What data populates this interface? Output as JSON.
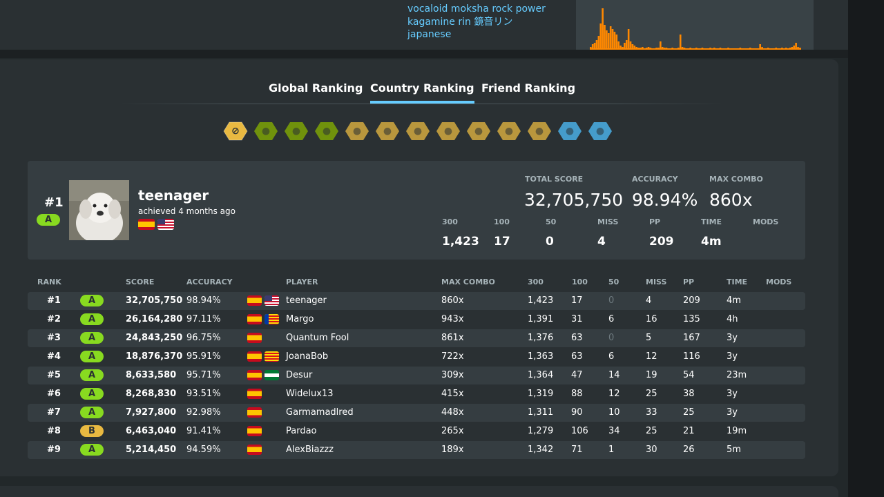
{
  "tags": [
    "vocaloid moksha rock power",
    "kagamine rin 鏡音リン",
    "japanese"
  ],
  "tabs": [
    {
      "label": "Global Ranking",
      "active": false
    },
    {
      "label": "Country Ranking",
      "active": true
    },
    {
      "label": "Friend Ranking",
      "active": false
    }
  ],
  "mods": [
    {
      "name": "no-mod",
      "color": "#e9b941"
    },
    {
      "name": "easy",
      "color": "#88b300"
    },
    {
      "name": "no-fail",
      "color": "#88b300"
    },
    {
      "name": "half-time",
      "color": "#88b300"
    },
    {
      "name": "hard-rock",
      "color": "#e9b941"
    },
    {
      "name": "sudden-death",
      "color": "#e9b941"
    },
    {
      "name": "perfect",
      "color": "#e9b941"
    },
    {
      "name": "double-time",
      "color": "#e9b941"
    },
    {
      "name": "hidden",
      "color": "#e9b941"
    },
    {
      "name": "flashlight",
      "color": "#e9b941"
    },
    {
      "name": "spun-out",
      "color": "#e9b941"
    },
    {
      "name": "relax",
      "color": "#4fc0ff"
    },
    {
      "name": "auto",
      "color": "#4fc0ff"
    }
  ],
  "top_score": {
    "rank": "#1",
    "grade": "A",
    "player": "teenager",
    "achieved": "achieved 4 months ago",
    "flags": [
      "es",
      "us"
    ],
    "labels": {
      "total_score": "TOTAL SCORE",
      "accuracy": "ACCURACY",
      "max_combo": "MAX COMBO",
      "c300": "300",
      "c100": "100",
      "c50": "50",
      "miss": "MISS",
      "pp": "PP",
      "time": "TIME",
      "mods": "MODS"
    },
    "total_score": "32,705,750",
    "accuracy": "98.94%",
    "max_combo": "860x",
    "c300": "1,423",
    "c100": "17",
    "c50": "0",
    "miss": "4",
    "pp": "209",
    "time": "4m"
  },
  "table_headers": {
    "rank": "RANK",
    "score": "SCORE",
    "accuracy": "ACCURACY",
    "player": "PLAYER",
    "max_combo": "MAX COMBO",
    "c300": "300",
    "c100": "100",
    "c50": "50",
    "miss": "MISS",
    "pp": "PP",
    "time": "TIME",
    "mods": "MODS"
  },
  "rows": [
    {
      "rank": "#1",
      "grade": "A",
      "score": "32,705,750",
      "accuracy": "98.94%",
      "flags": [
        "es",
        "us"
      ],
      "player": "teenager",
      "max_combo": "860x",
      "c300": "1,423",
      "c100": "17",
      "c50": "0",
      "miss": "4",
      "pp": "209",
      "time": "4m"
    },
    {
      "rank": "#2",
      "grade": "A",
      "score": "26,164,280",
      "accuracy": "97.11%",
      "flags": [
        "es",
        "vl"
      ],
      "player": "Margo",
      "max_combo": "943x",
      "c300": "1,391",
      "c100": "31",
      "c50": "6",
      "miss": "16",
      "pp": "135",
      "time": "4h"
    },
    {
      "rank": "#3",
      "grade": "A",
      "score": "24,843,250",
      "accuracy": "96.75%",
      "flags": [
        "es"
      ],
      "player": "Quantum Fool",
      "max_combo": "861x",
      "c300": "1,376",
      "c100": "63",
      "c50": "0",
      "miss": "5",
      "pp": "167",
      "time": "3y"
    },
    {
      "rank": "#4",
      "grade": "A",
      "score": "18,876,370",
      "accuracy": "95.91%",
      "flags": [
        "es",
        "cat"
      ],
      "player": "JoanaBob",
      "max_combo": "722x",
      "c300": "1,363",
      "c100": "63",
      "c50": "6",
      "miss": "12",
      "pp": "116",
      "time": "3y"
    },
    {
      "rank": "#5",
      "grade": "A",
      "score": "8,633,580",
      "accuracy": "95.71%",
      "flags": [
        "es",
        "an"
      ],
      "player": "Desur",
      "max_combo": "309x",
      "c300": "1,364",
      "c100": "47",
      "c50": "14",
      "miss": "19",
      "pp": "54",
      "time": "23m"
    },
    {
      "rank": "#6",
      "grade": "A",
      "score": "8,268,830",
      "accuracy": "93.51%",
      "flags": [
        "es"
      ],
      "player": "Widelux13",
      "max_combo": "415x",
      "c300": "1,319",
      "c100": "88",
      "c50": "12",
      "miss": "25",
      "pp": "38",
      "time": "3y"
    },
    {
      "rank": "#7",
      "grade": "A",
      "score": "7,927,800",
      "accuracy": "92.98%",
      "flags": [
        "es"
      ],
      "player": "Garmamadlred",
      "max_combo": "448x",
      "c300": "1,311",
      "c100": "90",
      "c50": "10",
      "miss": "33",
      "pp": "25",
      "time": "3y"
    },
    {
      "rank": "#8",
      "grade": "B",
      "score": "6,463,040",
      "accuracy": "91.41%",
      "flags": [
        "es"
      ],
      "player": "Pardao",
      "max_combo": "265x",
      "c300": "1,279",
      "c100": "106",
      "c50": "34",
      "miss": "25",
      "pp": "21",
      "time": "19m"
    },
    {
      "rank": "#9",
      "grade": "A",
      "score": "5,214,450",
      "accuracy": "94.59%",
      "flags": [
        "es"
      ],
      "player": "AlexBiazzz",
      "max_combo": "189x",
      "c300": "1,342",
      "c100": "71",
      "c50": "1",
      "miss": "30",
      "pp": "26",
      "time": "5m"
    }
  ],
  "colors": {
    "accent": "#66ccff",
    "grade_a": "#88da20",
    "grade_b": "#e9b941",
    "graph": "#ff8800"
  }
}
